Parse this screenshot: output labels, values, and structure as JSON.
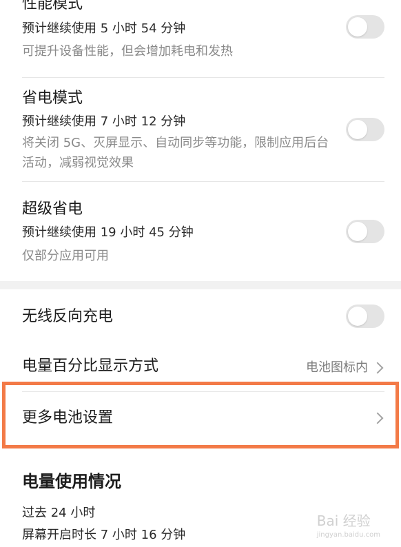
{
  "modes": [
    {
      "title": "性能模式",
      "estimate": "预计继续使用 5 小时 54 分钟",
      "description": "可提升设备性能，但会增加耗电和发热",
      "enabled": false
    },
    {
      "title": "省电模式",
      "estimate": "预计继续使用 7 小时 12 分钟",
      "description": "将关闭 5G、灭屏显示、自动同步等功能，限制应用后台活动，减弱视觉效果",
      "enabled": false
    },
    {
      "title": "超级省电",
      "estimate": "预计继续使用 19 小时 45 分钟",
      "description": "仅部分应用可用",
      "enabled": false
    }
  ],
  "wireless_reverse": {
    "title": "无线反向充电",
    "enabled": false
  },
  "percentage_display": {
    "title": "电量百分比显示方式",
    "value": "电池图标内"
  },
  "more_settings": {
    "title": "更多电池设置"
  },
  "usage": {
    "title": "电量使用情况",
    "period": "过去 24 小时",
    "screen_on": "屏幕开启时长 7 小时 16 分钟"
  },
  "colors": {
    "highlight": "#f37a47",
    "toggle_off": "#e4e4e4"
  },
  "watermark": {
    "brand": "Bai 经验",
    "url": "jingyan.baidu.com"
  }
}
